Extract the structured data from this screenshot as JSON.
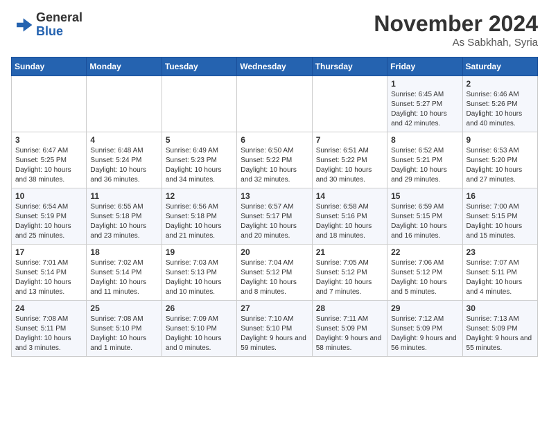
{
  "header": {
    "logo_line1": "General",
    "logo_line2": "Blue",
    "month": "November 2024",
    "location": "As Sabkhah, Syria"
  },
  "days_of_week": [
    "Sunday",
    "Monday",
    "Tuesday",
    "Wednesday",
    "Thursday",
    "Friday",
    "Saturday"
  ],
  "weeks": [
    [
      {
        "day": "",
        "info": ""
      },
      {
        "day": "",
        "info": ""
      },
      {
        "day": "",
        "info": ""
      },
      {
        "day": "",
        "info": ""
      },
      {
        "day": "",
        "info": ""
      },
      {
        "day": "1",
        "info": "Sunrise: 6:45 AM\nSunset: 5:27 PM\nDaylight: 10 hours and 42 minutes."
      },
      {
        "day": "2",
        "info": "Sunrise: 6:46 AM\nSunset: 5:26 PM\nDaylight: 10 hours and 40 minutes."
      }
    ],
    [
      {
        "day": "3",
        "info": "Sunrise: 6:47 AM\nSunset: 5:25 PM\nDaylight: 10 hours and 38 minutes."
      },
      {
        "day": "4",
        "info": "Sunrise: 6:48 AM\nSunset: 5:24 PM\nDaylight: 10 hours and 36 minutes."
      },
      {
        "day": "5",
        "info": "Sunrise: 6:49 AM\nSunset: 5:23 PM\nDaylight: 10 hours and 34 minutes."
      },
      {
        "day": "6",
        "info": "Sunrise: 6:50 AM\nSunset: 5:22 PM\nDaylight: 10 hours and 32 minutes."
      },
      {
        "day": "7",
        "info": "Sunrise: 6:51 AM\nSunset: 5:22 PM\nDaylight: 10 hours and 30 minutes."
      },
      {
        "day": "8",
        "info": "Sunrise: 6:52 AM\nSunset: 5:21 PM\nDaylight: 10 hours and 29 minutes."
      },
      {
        "day": "9",
        "info": "Sunrise: 6:53 AM\nSunset: 5:20 PM\nDaylight: 10 hours and 27 minutes."
      }
    ],
    [
      {
        "day": "10",
        "info": "Sunrise: 6:54 AM\nSunset: 5:19 PM\nDaylight: 10 hours and 25 minutes."
      },
      {
        "day": "11",
        "info": "Sunrise: 6:55 AM\nSunset: 5:18 PM\nDaylight: 10 hours and 23 minutes."
      },
      {
        "day": "12",
        "info": "Sunrise: 6:56 AM\nSunset: 5:18 PM\nDaylight: 10 hours and 21 minutes."
      },
      {
        "day": "13",
        "info": "Sunrise: 6:57 AM\nSunset: 5:17 PM\nDaylight: 10 hours and 20 minutes."
      },
      {
        "day": "14",
        "info": "Sunrise: 6:58 AM\nSunset: 5:16 PM\nDaylight: 10 hours and 18 minutes."
      },
      {
        "day": "15",
        "info": "Sunrise: 6:59 AM\nSunset: 5:15 PM\nDaylight: 10 hours and 16 minutes."
      },
      {
        "day": "16",
        "info": "Sunrise: 7:00 AM\nSunset: 5:15 PM\nDaylight: 10 hours and 15 minutes."
      }
    ],
    [
      {
        "day": "17",
        "info": "Sunrise: 7:01 AM\nSunset: 5:14 PM\nDaylight: 10 hours and 13 minutes."
      },
      {
        "day": "18",
        "info": "Sunrise: 7:02 AM\nSunset: 5:14 PM\nDaylight: 10 hours and 11 minutes."
      },
      {
        "day": "19",
        "info": "Sunrise: 7:03 AM\nSunset: 5:13 PM\nDaylight: 10 hours and 10 minutes."
      },
      {
        "day": "20",
        "info": "Sunrise: 7:04 AM\nSunset: 5:12 PM\nDaylight: 10 hours and 8 minutes."
      },
      {
        "day": "21",
        "info": "Sunrise: 7:05 AM\nSunset: 5:12 PM\nDaylight: 10 hours and 7 minutes."
      },
      {
        "day": "22",
        "info": "Sunrise: 7:06 AM\nSunset: 5:12 PM\nDaylight: 10 hours and 5 minutes."
      },
      {
        "day": "23",
        "info": "Sunrise: 7:07 AM\nSunset: 5:11 PM\nDaylight: 10 hours and 4 minutes."
      }
    ],
    [
      {
        "day": "24",
        "info": "Sunrise: 7:08 AM\nSunset: 5:11 PM\nDaylight: 10 hours and 3 minutes."
      },
      {
        "day": "25",
        "info": "Sunrise: 7:08 AM\nSunset: 5:10 PM\nDaylight: 10 hours and 1 minute."
      },
      {
        "day": "26",
        "info": "Sunrise: 7:09 AM\nSunset: 5:10 PM\nDaylight: 10 hours and 0 minutes."
      },
      {
        "day": "27",
        "info": "Sunrise: 7:10 AM\nSunset: 5:10 PM\nDaylight: 9 hours and 59 minutes."
      },
      {
        "day": "28",
        "info": "Sunrise: 7:11 AM\nSunset: 5:09 PM\nDaylight: 9 hours and 58 minutes."
      },
      {
        "day": "29",
        "info": "Sunrise: 7:12 AM\nSunset: 5:09 PM\nDaylight: 9 hours and 56 minutes."
      },
      {
        "day": "30",
        "info": "Sunrise: 7:13 AM\nSunset: 5:09 PM\nDaylight: 9 hours and 55 minutes."
      }
    ]
  ]
}
